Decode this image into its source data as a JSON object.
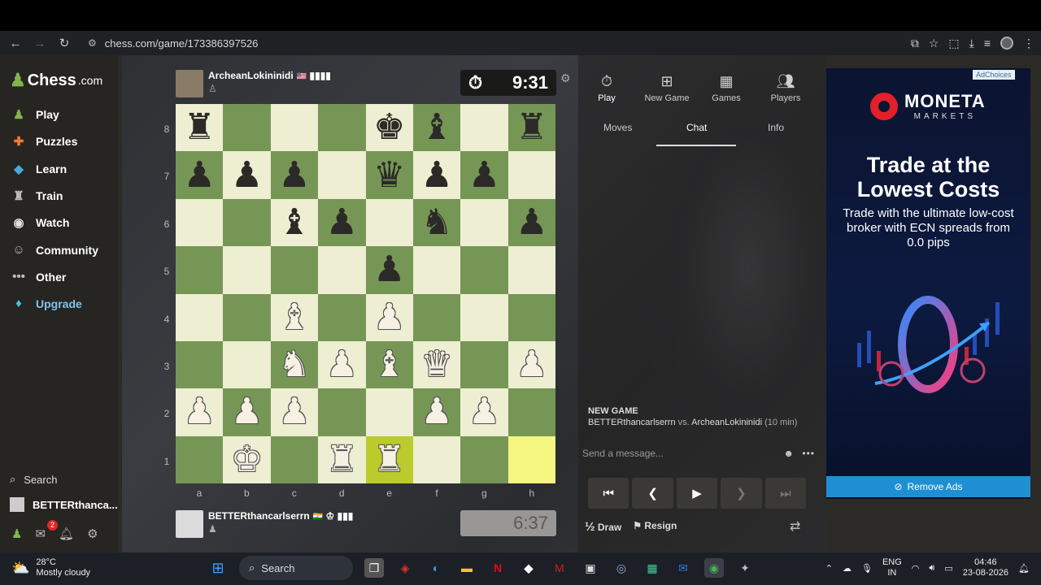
{
  "browser": {
    "url": "chess.com/game/173386397526",
    "back": "←",
    "forward": "→",
    "reload": "↻"
  },
  "sidebar": {
    "logo_main": "Chess",
    "logo_suffix": ".com",
    "items": [
      {
        "label": "Play",
        "icon": "pawn-icon"
      },
      {
        "label": "Puzzles",
        "icon": "puzzle-icon"
      },
      {
        "label": "Learn",
        "icon": "graduation-icon"
      },
      {
        "label": "Train",
        "icon": "train-icon"
      },
      {
        "label": "Watch",
        "icon": "binoculars-icon"
      },
      {
        "label": "Community",
        "icon": "community-icon"
      },
      {
        "label": "Other",
        "icon": "ellipsis-icon"
      },
      {
        "label": "Upgrade",
        "icon": "diamond-icon"
      }
    ],
    "search_label": "Search",
    "account_name": "BETTERthanca...",
    "mail_badge": "2"
  },
  "game": {
    "top_player": {
      "name": "ArcheanLokininidi",
      "flag": "🇺🇸",
      "bars": "▮▮▮▮",
      "clock": "9:31"
    },
    "bottom_player": {
      "name": "BETTERthancarlserrn",
      "flag": "🇮🇳",
      "bars": "♔ ▮▮▮",
      "clock": "6:37"
    },
    "ranks": [
      "8",
      "7",
      "6",
      "5",
      "4",
      "3",
      "2",
      "1"
    ],
    "files": [
      "a",
      "b",
      "c",
      "d",
      "e",
      "f",
      "g",
      "h"
    ],
    "board": [
      [
        "r",
        "",
        "",
        "",
        "k",
        "b",
        "",
        "r"
      ],
      [
        "p",
        "p",
        "p",
        "",
        "q",
        "p",
        "p",
        ""
      ],
      [
        "",
        "",
        "b",
        "p",
        "",
        "n",
        "",
        "p"
      ],
      [
        "",
        "",
        "",
        "",
        "p",
        "",
        "",
        ""
      ],
      [
        "",
        "",
        "B",
        "",
        "P",
        "",
        "",
        ""
      ],
      [
        "",
        "",
        "N",
        "P",
        "B",
        "Q",
        "",
        "P"
      ],
      [
        "P",
        "P",
        "P",
        "",
        "",
        "P",
        "P",
        ""
      ],
      [
        "",
        "K",
        "",
        "R",
        "R",
        "",
        "",
        ""
      ]
    ],
    "highlight_squares": [
      "e1",
      "h1"
    ]
  },
  "panel": {
    "tabs": [
      "Play",
      "New Game",
      "Games",
      "Players"
    ],
    "subtabs": [
      "Moves",
      "Chat",
      "Info"
    ],
    "active_subtab": "Chat",
    "new_game_header": "NEW GAME",
    "white_player": "BETTERthancarlserrn",
    "vs": "vs.",
    "black_player": "ArcheanLokininidi",
    "time_control": "(10 min)",
    "chat_placeholder": "Send a message...",
    "draw_label": "Draw",
    "draw_prefix": "½",
    "resign_label": "Resign"
  },
  "ad": {
    "choices": "AdChoices",
    "brand": "MONETA",
    "brand_sub": "MARKETS",
    "headline": "Trade at the Lowest Costs",
    "body": "Trade with the ultimate low-cost broker with ECN spreads from 0.0 pips",
    "remove_ads": "Remove Ads"
  },
  "taskbar": {
    "temp": "28°C",
    "weather": "Mostly cloudy",
    "search": "Search",
    "lang1": "ENG",
    "lang2": "IN",
    "time": "04:46",
    "date": "23-08-2026"
  }
}
